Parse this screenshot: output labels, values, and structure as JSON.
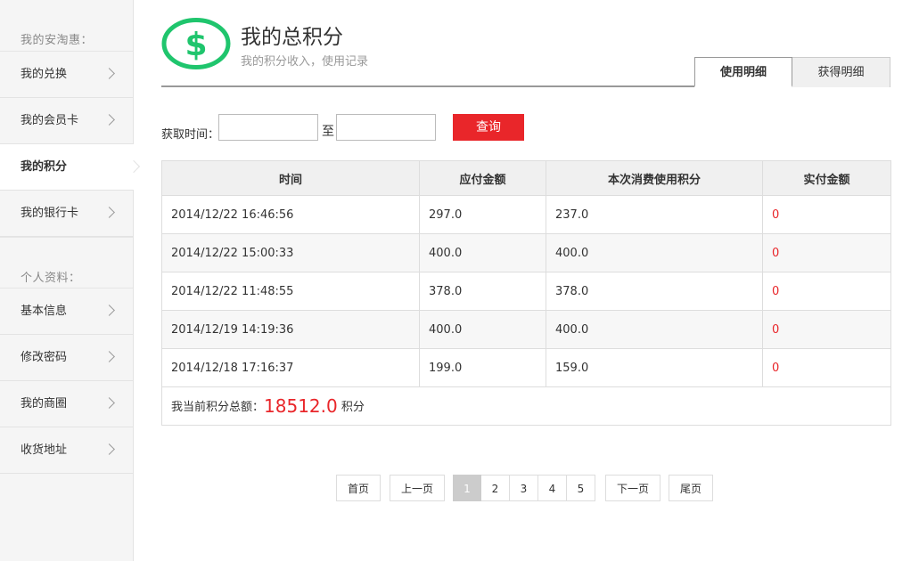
{
  "sidebar": {
    "section1_title": "我的安淘惠：",
    "section1_items": [
      {
        "label": "我的兑换"
      },
      {
        "label": "我的会员卡"
      },
      {
        "label": "我的积分"
      },
      {
        "label": "我的银行卡"
      }
    ],
    "section2_title": "个人资料：",
    "section2_items": [
      {
        "label": "基本信息"
      },
      {
        "label": "修改密码"
      },
      {
        "label": "我的商圈"
      },
      {
        "label": "收货地址"
      }
    ],
    "active_item": "我的积分"
  },
  "header": {
    "title": "我的总积分",
    "subtitle": "我的积分收入，使用记录",
    "icon": "dollar-circle-icon",
    "icon_color": "#1fc56d"
  },
  "tabs": [
    {
      "label": "使用明细",
      "active": true
    },
    {
      "label": "获得明细",
      "active": false
    }
  ],
  "filter": {
    "label": "获取时间：",
    "from_value": "",
    "to_sep": "至",
    "to_value": "",
    "query_label": "查询"
  },
  "table": {
    "headers": [
      "时间",
      "应付金额",
      "本次消费使用积分",
      "实付金额"
    ],
    "rows": [
      [
        "2014/12/22 16:46:56",
        "297.0",
        "237.0",
        "0"
      ],
      [
        "2014/12/22 15:00:33",
        "400.0",
        "400.0",
        "0"
      ],
      [
        "2014/12/22 11:48:55",
        "378.0",
        "378.0",
        "0"
      ],
      [
        "2014/12/19 14:19:36",
        "400.0",
        "400.0",
        "0"
      ],
      [
        "2014/12/18 17:16:37",
        "199.0",
        "159.0",
        "0"
      ]
    ],
    "total_label": "我当前积分总额：",
    "total_value": "18512.0",
    "total_unit": "积分"
  },
  "pager": {
    "first": "首页",
    "prev": "上一页",
    "pages": [
      "1",
      "2",
      "3",
      "4",
      "5"
    ],
    "current": "1",
    "next": "下一页",
    "last": "尾页"
  },
  "colors": {
    "accent_red": "#e9262a",
    "icon_green": "#1fc56d"
  }
}
